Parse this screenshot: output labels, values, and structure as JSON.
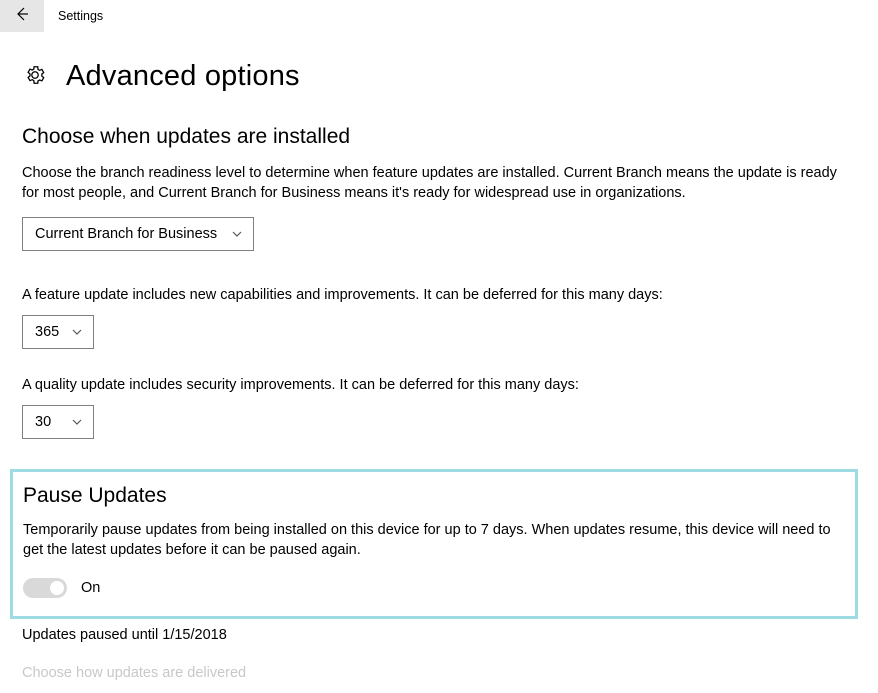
{
  "window": {
    "title": "Settings"
  },
  "page": {
    "title": "Advanced options"
  },
  "section1": {
    "heading": "Choose when updates are installed",
    "description": "Choose the branch readiness level to determine when feature updates are installed. Current Branch means the update is ready for most people, and Current Branch for Business means it's ready for widespread use in organizations.",
    "branch_dropdown": "Current Branch for Business",
    "feature_text": "A feature update includes new capabilities and improvements. It can be deferred for this many days:",
    "feature_value": "365",
    "quality_text": "A quality update includes security improvements. It can be deferred for this many days:",
    "quality_value": "30"
  },
  "pause": {
    "heading": "Pause Updates",
    "description": "Temporarily pause updates from being installed on this device for up to 7 days. When updates resume, this device will need to get the latest updates before it can be paused again.",
    "toggle_state": "On",
    "paused_until": "Updates paused until  1/15/2018"
  },
  "delivery": {
    "link": "Choose how updates are delivered"
  }
}
